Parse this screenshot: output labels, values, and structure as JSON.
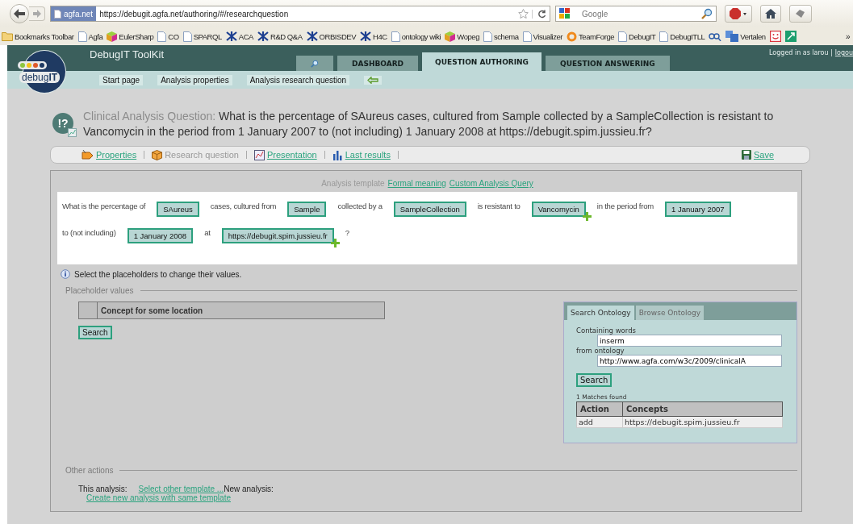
{
  "browser": {
    "url_badge": "agfa.net",
    "url": "https://debugit.agfa.net/authoring/#/researchquestion",
    "search_placeholder": "Google"
  },
  "bookmarks": [
    {
      "kind": "folder",
      "label": "Bookmarks Toolbar"
    },
    {
      "kind": "page",
      "label": "Agfa"
    },
    {
      "kind": "cube",
      "label": "EulerSharp"
    },
    {
      "kind": "page",
      "label": "CO"
    },
    {
      "kind": "page",
      "label": "SPARQL"
    },
    {
      "kind": "star",
      "label": "ACA"
    },
    {
      "kind": "star",
      "label": "R&D Q&A"
    },
    {
      "kind": "star",
      "label": "ORBISDEV"
    },
    {
      "kind": "star",
      "label": "H4C"
    },
    {
      "kind": "page",
      "label": "ontology wiki"
    },
    {
      "kind": "cube",
      "label": "Wopeg"
    },
    {
      "kind": "page",
      "label": "schema"
    },
    {
      "kind": "page",
      "label": "Visualizer"
    },
    {
      "kind": "ring",
      "label": "TeamForge"
    },
    {
      "kind": "page",
      "label": "DebugIT"
    },
    {
      "kind": "page",
      "label": "DebugITLL"
    },
    {
      "kind": "glasses"
    },
    {
      "kind": "translate",
      "label": "Vertalen"
    },
    {
      "kind": "smiley"
    },
    {
      "kind": "arrows"
    }
  ],
  "bookmarks_more": "»",
  "app": {
    "title": "DebugIT ToolKit",
    "logo": "debug**IT**",
    "login_text": "Logged in as larou |",
    "login_link": "logou"
  },
  "tabs": [
    {
      "kind": "search",
      "selected": false
    },
    {
      "kind": "text",
      "label": "DASHBOARD",
      "selected": false
    },
    {
      "kind": "text",
      "label": "QUESTION AUTHORING",
      "selected": true
    },
    {
      "kind": "text",
      "label": "QUESTION ANSWERING",
      "selected": false
    }
  ],
  "subnav": [
    "Start page",
    "Analysis properties",
    "Analysis research question"
  ],
  "question": {
    "icon_text": "!?",
    "label": "Clinical Analysis Question:",
    "text": "What is the percentage of SAureus cases, cultured from Sample collected by a SampleCollection is resistant to Vancomycin in the period from 1 January 2007 to (not including) 1 January 2008 at https://debugit.spim.jussieu.fr?"
  },
  "actions": [
    {
      "kind": "tag",
      "label": "Properties",
      "link": true
    },
    {
      "kind": "cube",
      "label": "Research question",
      "link": false
    },
    {
      "kind": "chart",
      "label": "Presentation",
      "link": true
    },
    {
      "kind": "bars",
      "label": "Last results",
      "link": true
    }
  ],
  "save": "Save",
  "template": {
    "label": "Analysis template",
    "links": [
      "Formal meaning",
      "Custom Analysis Query"
    ]
  },
  "sentence": [
    [
      {
        "kind": "text",
        "text": "What is the percentage of"
      },
      {
        "kind": "placeholder",
        "text": "SAureus",
        "addable": false
      },
      {
        "kind": "text",
        "text": "cases, cultured from"
      },
      {
        "kind": "placeholder",
        "text": "Sample",
        "addable": false
      },
      {
        "kind": "text",
        "text": "collected by a"
      },
      {
        "kind": "placeholder",
        "text": "SampleCollection",
        "addable": false
      },
      {
        "kind": "text",
        "text": "is resistant to"
      },
      {
        "kind": "placeholder",
        "text": "Vancomycin",
        "addable": true
      },
      {
        "kind": "text",
        "text": "in the period from"
      },
      {
        "kind": "placeholder",
        "text": "1 January 2007",
        "addable": false
      }
    ],
    [
      {
        "kind": "text",
        "text": "to (not including)"
      },
      {
        "kind": "placeholder",
        "text": "1 January 2008",
        "addable": false
      },
      {
        "kind": "text",
        "text": "at"
      },
      {
        "kind": "placeholder",
        "text": "https://debugit.spim.jussieu.fr",
        "addable": true
      },
      {
        "kind": "text",
        "text": "?"
      }
    ]
  ],
  "hint": "Select the placeholders to change their values.",
  "placeholder_values": {
    "legend": "Placeholder values",
    "column": "Concept for some location",
    "button": "Search"
  },
  "ontology": {
    "tabs": [
      {
        "label": "Search Ontology",
        "selected": true
      },
      {
        "label": "Browse Ontology",
        "selected": false
      }
    ],
    "words_label": "Containing words",
    "words_value": "inserm",
    "from_label": "from ontology",
    "from_value": "http://www.agfa.com/w3c/2009/clinicalA",
    "button": "Search",
    "matches": "1 Matches found",
    "columns": [
      "Action",
      "Concepts"
    ],
    "rows": [
      [
        "add",
        "https://debugit.spim.jussieu.fr"
      ]
    ]
  },
  "other_actions": {
    "legend": "Other actions",
    "this_label": "This analysis:",
    "select_link": "Select other template ...",
    "new_label": "New analysis:",
    "create_link": "Create new analysis with same template"
  }
}
